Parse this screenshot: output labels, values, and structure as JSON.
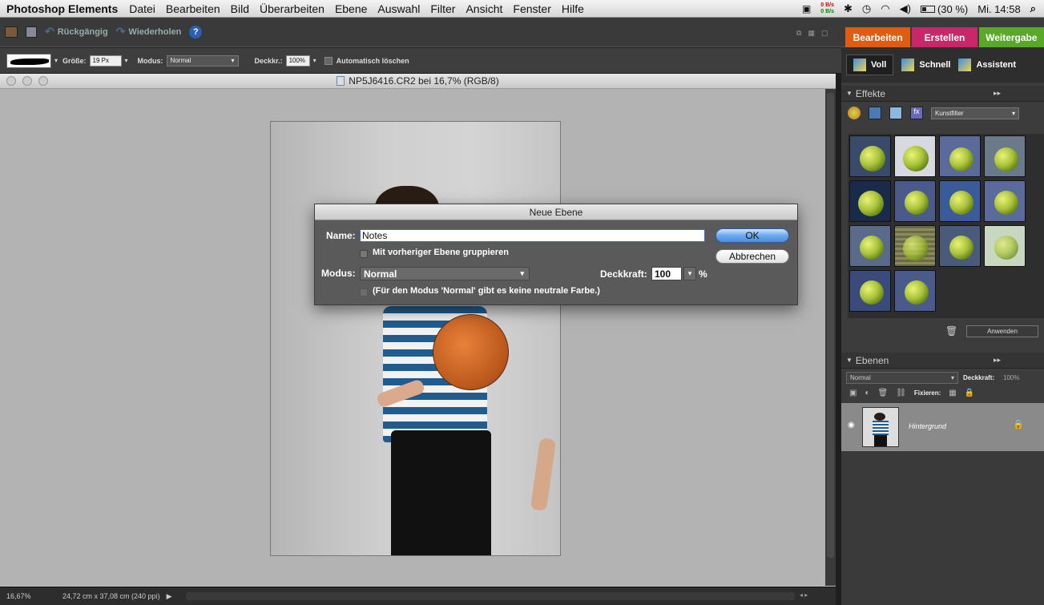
{
  "menubar": {
    "app": "Photoshop Elements",
    "items": [
      "Datei",
      "Bearbeiten",
      "Bild",
      "Überarbeiten",
      "Ebene",
      "Auswahl",
      "Filter",
      "Ansicht",
      "Fenster",
      "Hilfe"
    ],
    "net_up": "0 B/s",
    "net_down": "0 B/s",
    "battery": "(30 %)",
    "clock": "Mi. 14:58"
  },
  "toolbar": {
    "undo": "Rückgängig",
    "redo": "Wiederholen"
  },
  "mode_tabs": [
    "Bearbeiten",
    "Erstellen",
    "Weitergabe"
  ],
  "mode_tab_colors": [
    "#e05c10",
    "#c8286a",
    "#5aa82a"
  ],
  "edit_modes": [
    "Voll",
    "Schnell",
    "Assistent"
  ],
  "options": {
    "size_label": "Größe:",
    "size_value": "19 Px",
    "mode_label": "Modus:",
    "mode_value": "Normal",
    "opacity_label": "Deckkr.:",
    "opacity_value": "100%",
    "auto_erase": "Automatisch löschen"
  },
  "document": {
    "title": "NP5J6416.CR2 bei 16,7% (RGB/8)",
    "zoom": "16,67%",
    "dimensions": "24,72 cm x 37,08 cm (240 ppi)"
  },
  "dialog": {
    "title": "Neue Ebene",
    "name_label": "Name:",
    "name_value": "Notes",
    "group_label": "Mit vorheriger Ebene gruppieren",
    "mode_label": "Modus:",
    "mode_value": "Normal",
    "opacity_label": "Deckkraft:",
    "opacity_value": "100",
    "percent": "%",
    "neutral_label": "(Für den Modus 'Normal' gibt es keine neutrale Farbe.)",
    "ok": "OK",
    "cancel": "Abbrechen"
  },
  "effects": {
    "title": "Effekte",
    "filter_select": "Kunstfilter",
    "apply": "Anwenden"
  },
  "layers": {
    "title": "Ebenen",
    "blend": "Normal",
    "opacity_label": "Deckkraft:",
    "opacity_value": "100%",
    "lock_label": "Fixieren:",
    "items": [
      {
        "name": "Hintergrund"
      }
    ]
  }
}
